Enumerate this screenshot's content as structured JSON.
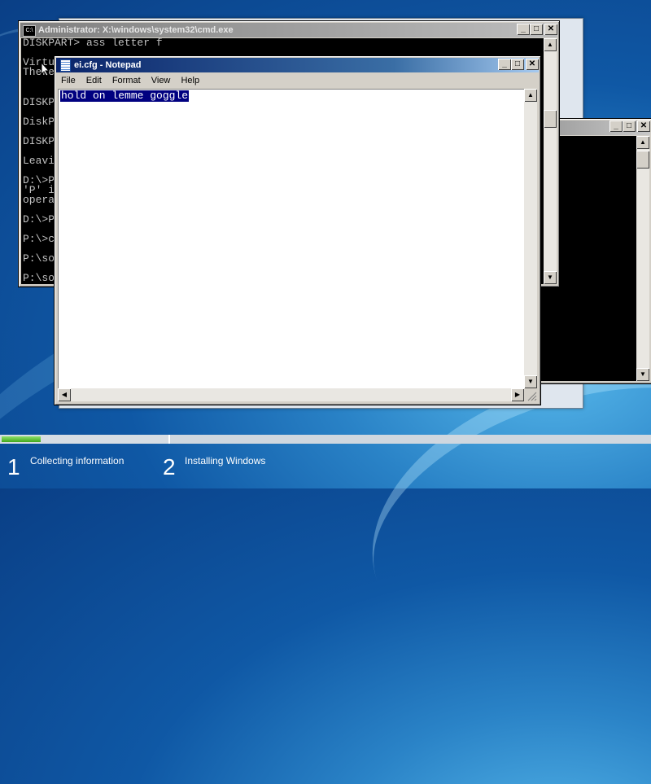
{
  "cmd": {
    "title": "Administrator: X:\\windows\\system32\\cmd.exe",
    "icon": "C:\\",
    "lines": [
      "DISKPART> ass letter f",
      "",
      "Virtu",
      "Theres",
      "",
      "",
      "DISKP",
      "",
      "DiskP",
      "",
      "DISKP",
      "",
      "Leavi",
      "",
      "D:\\>P",
      "'P' i",
      "opera",
      "",
      "D:\\>P",
      "",
      "P:\\>c",
      "",
      "P:\\so",
      "",
      "P:\\so"
    ]
  },
  "notepad": {
    "title": "ei.cfg - Notepad",
    "menu": [
      "File",
      "Edit",
      "Format",
      "View",
      "Help"
    ],
    "text": "hold on lemme goggle"
  },
  "setup": {
    "progress": 0.24,
    "steps": [
      {
        "number": "1",
        "label": "Collecting information"
      },
      {
        "number": "2",
        "label": "Installing Windows"
      }
    ]
  },
  "colors": {
    "titlebar_active": "#0a246a",
    "selection": "#000080",
    "progress_fill": "#41a71d"
  }
}
